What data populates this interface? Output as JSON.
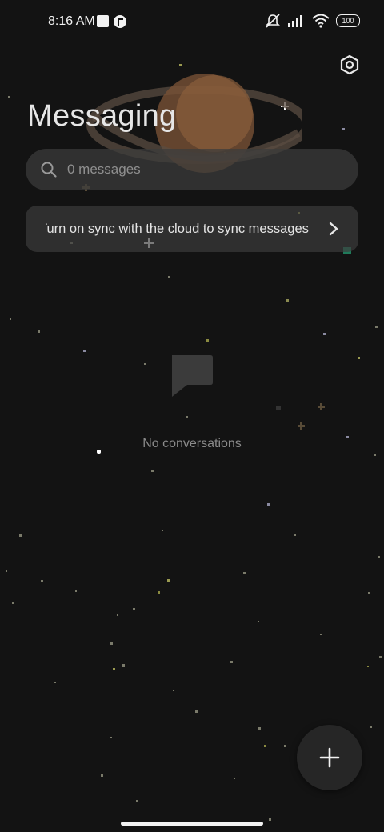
{
  "status_bar": {
    "time": "8:16 AM",
    "battery": "100",
    "icons": [
      "notification-square-icon",
      "app-notification-icon",
      "mute-icon",
      "signal-icon",
      "wifi-icon",
      "battery-icon"
    ]
  },
  "header": {
    "title": "Messaging",
    "settings_icon": "settings-hexagon-icon"
  },
  "search": {
    "placeholder": "0 messages",
    "icon": "search-icon"
  },
  "sync_banner": {
    "text": "Turn on sync with the cloud to sync messages",
    "icon": "chevron-right-icon"
  },
  "empty_state": {
    "icon": "chat-bubble-icon",
    "text": "No conversations"
  },
  "fab": {
    "icon": "plus-icon"
  },
  "colors": {
    "background": "#131313",
    "surface": "#3c3c3c",
    "text_primary": "#e6e6e6",
    "text_secondary": "#8a8a8a",
    "planet": "#8a5a36"
  }
}
